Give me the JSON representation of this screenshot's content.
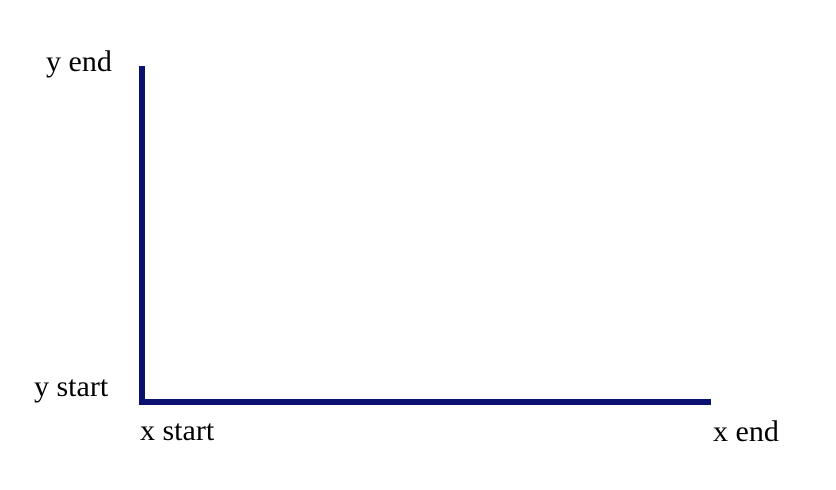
{
  "colors": {
    "background": "#ffffff",
    "axis": "#0b1170",
    "text": "#000000"
  },
  "labels": {
    "y_end": "y end",
    "y_start": "y start",
    "x_start": "x start",
    "x_end": "x end"
  }
}
